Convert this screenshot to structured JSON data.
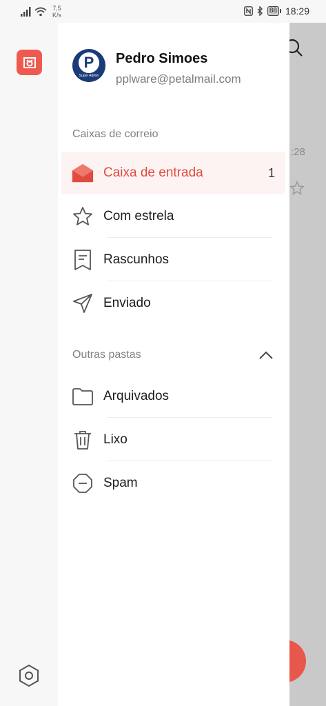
{
  "status_bar": {
    "speed": "7,5",
    "speed_unit": "K/s",
    "battery": "88",
    "time": "18:29"
  },
  "account": {
    "name": "Pedro Simoes",
    "email": "pplware@petalmail.com",
    "avatar_letter": "P",
    "avatar_subtext": "Super Admin"
  },
  "mailboxes": {
    "header": "Caixas de correio",
    "items": [
      {
        "label": "Caixa de entrada",
        "count": "1",
        "icon": "inbox-icon"
      },
      {
        "label": "Com estrela",
        "icon": "star-icon"
      },
      {
        "label": "Rascunhos",
        "icon": "drafts-icon"
      },
      {
        "label": "Enviado",
        "icon": "send-icon"
      }
    ]
  },
  "other_folders": {
    "header": "Outras pastas",
    "items": [
      {
        "label": "Arquivados",
        "icon": "folder-icon"
      },
      {
        "label": "Lixo",
        "icon": "trash-icon"
      },
      {
        "label": "Spam",
        "icon": "spam-icon"
      }
    ]
  },
  "background": {
    "time_fragment": ":28"
  },
  "colors": {
    "accent": "#e04b3f",
    "active_bg": "#fdf3f2",
    "logo": "#ee5a4f",
    "avatar": "#1a3b78"
  }
}
